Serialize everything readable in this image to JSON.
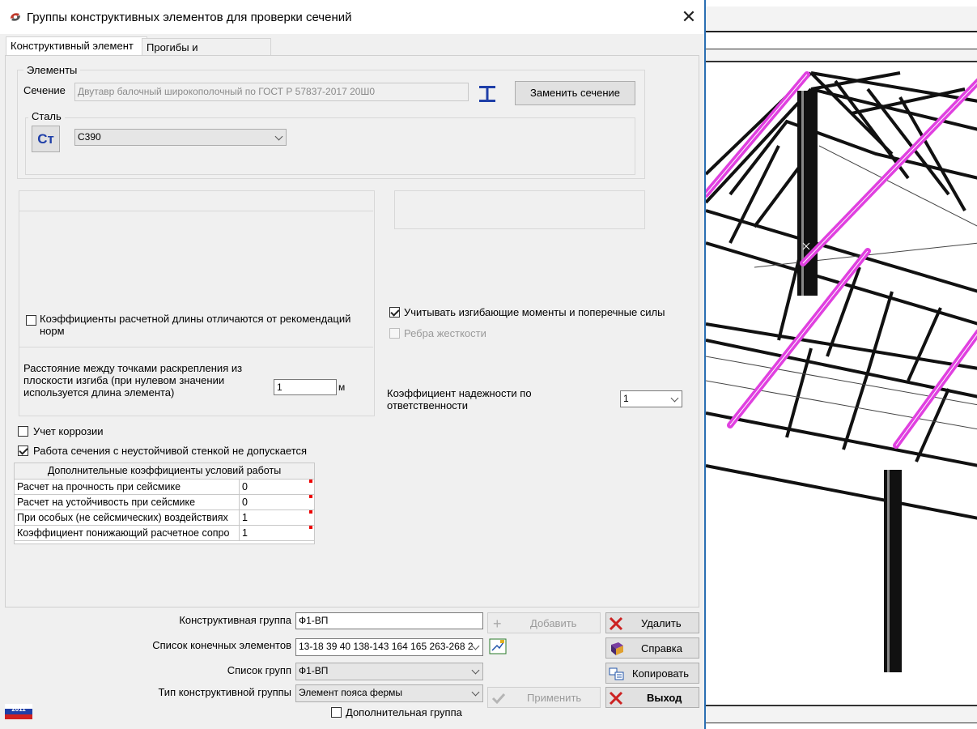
{
  "window": {
    "title": "Группы конструктивных элементов для проверки сечений",
    "close_symbol": "✕"
  },
  "tabs": [
    {
      "label": "Конструктивный элемент",
      "active": true
    },
    {
      "label": "Прогибы и перемещения",
      "active": false
    }
  ],
  "elements_group": {
    "legend": "Элементы",
    "section_label": "Сечение",
    "section_value": "Двутавр балочный широкополочный по ГОСТ Р 57837-2017 20Ш0",
    "replace_button": "Заменить сечение",
    "steel_legend": "Сталь",
    "steel_button": "Ст",
    "steel_value": "С390"
  },
  "left_options": {
    "calc_length_checkbox": {
      "label": "Коэффициенты расчетной длины отличаются от рекомендаций норм",
      "checked": false
    },
    "distance_label": "Расстояние между точками раскрепления из плоскости изгиба (при нулевом значении используется длина элемента)",
    "distance_value": "1",
    "distance_unit": "м"
  },
  "right_options": {
    "moments_checkbox": {
      "label": "Учитывать изгибающие моменты и поперечные силы",
      "checked": true
    },
    "stiffeners_checkbox": {
      "label": "Ребра жесткости",
      "checked": false,
      "disabled": true
    },
    "reliability_label": "Коэффициент надежности по ответственности",
    "reliability_value": "1"
  },
  "corrosion_checkbox": {
    "label": "Учет коррозии",
    "checked": false
  },
  "unstable_web_checkbox": {
    "label": "Работа сечения с неустойчивой стенкой не допускается",
    "checked": true
  },
  "coef_table": {
    "header": "Дополнительные коэффициенты условий работы",
    "rows": [
      {
        "name": "Расчет на прочность при сейсмике",
        "value": "0"
      },
      {
        "name": "Расчет на устойчивость при сейсмике",
        "value": "0"
      },
      {
        "name": "При особых (не сейсмических) воздействиях",
        "value": "1"
      },
      {
        "name": "Коэффициент понижающий расчетное сопро",
        "value": "1"
      }
    ]
  },
  "bottom": {
    "group_label": "Конструктивная группа",
    "group_value": "Ф1-ВП",
    "fe_list_label": "Список конечных элементов",
    "fe_list_value": "13-18 39 40 138-143 164 165 263-268 2",
    "groups_list_label": "Список групп",
    "groups_list_value": "Ф1-ВП",
    "type_label": "Тип конструктивной группы",
    "type_value": "Элемент пояса фермы",
    "additional_group": {
      "label": "Дополнительная группа",
      "checked": false
    },
    "add_button": "Добавить",
    "add_icon": "+",
    "apply_button": "Применить",
    "delete_button": "Удалить",
    "help_button": "Справка",
    "copy_button": "Копировать",
    "exit_button": "Выход"
  },
  "version_badge": "2011",
  "colors": {
    "highlight": "#e040e0",
    "accent": "#1f3fa8",
    "delete": "#cc2222"
  }
}
